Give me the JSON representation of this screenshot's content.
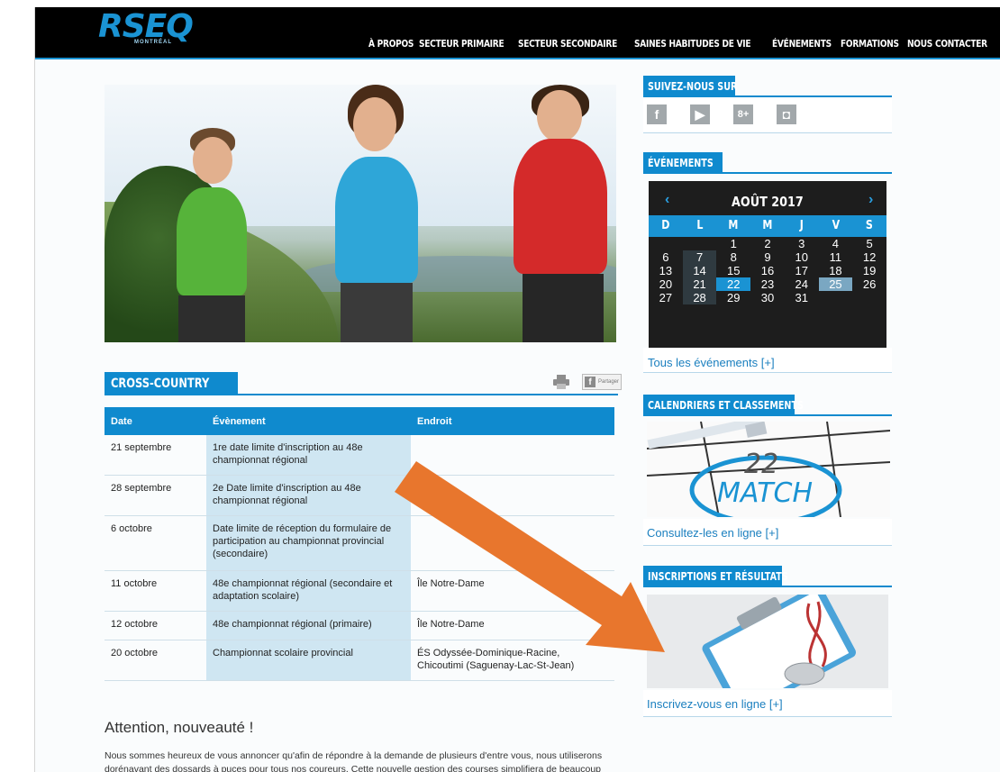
{
  "header": {
    "logo_text": "RSEQ",
    "logo_subtext": "MONTRÉAL",
    "nav": [
      "À PROPOS",
      "SECTEUR PRIMAIRE",
      "SECTEUR SECONDAIRE",
      "SAINES HABITUDES DE VIE",
      "ÉVÉNEMENTS",
      "FORMATIONS",
      "NOUS CONTACTER"
    ]
  },
  "colors": {
    "brand_blue": "#0f8ace",
    "arrow_orange": "#e8762d",
    "calendar_bg": "#1d1d1d"
  },
  "main": {
    "section_title": "CROSS-COUNTRY",
    "share_label": "Partager",
    "table": {
      "headers": [
        "Date",
        "Évènement",
        "Endroit"
      ],
      "rows": [
        {
          "date": "21 septembre",
          "event": "1re date limite d'inscription au 48e championnat régional",
          "place": ""
        },
        {
          "date": "28 septembre",
          "event": "2e Date limite d'inscription au 48e championnat régional",
          "place": ""
        },
        {
          "date": "6 octobre",
          "event": "Date limite de réception du formulaire de participation au championnat provincial (secondaire)",
          "place": ""
        },
        {
          "date": "11 octobre",
          "event": "48e championnat régional (secondaire et adaptation scolaire)",
          "place": "Île Notre-Dame"
        },
        {
          "date": "12 octobre",
          "event": "48e championnat régional (primaire)",
          "place": "Île Notre-Dame"
        },
        {
          "date": "20 octobre",
          "event": "Championnat scolaire provincial",
          "place": "ÉS Odyssée-Dominique-Racine, Chicoutimi (Saguenay-Lac-St-Jean)"
        }
      ]
    },
    "attention_title": "Attention, nouveauté !",
    "body_text": "Nous sommes heureux de vous annoncer qu'afin de répondre à la demande de plusieurs d'entre vous, nous utiliserons dorénavant des dossards à puces pour tous nos coureurs. Cette nouvelle gestion des courses simplifiera de beaucoup"
  },
  "sidebar": {
    "social_title": "SUIVEZ-NOUS SUR",
    "social_icons": [
      "facebook-icon",
      "youtube-icon",
      "google-plus-icon",
      "instagram-icon"
    ],
    "events_title": "ÉVÉNEMENTS",
    "calendar": {
      "month": "AOÛT 2017",
      "prev": "‹",
      "next": "›",
      "weekdays": [
        "D",
        "L",
        "M",
        "M",
        "J",
        "V",
        "S"
      ],
      "leading_blanks": 2,
      "days": 31,
      "highlight_today": 22,
      "highlight_selected": 25
    },
    "events_link": "Tous les événements [+]",
    "calendars_title": "CALENDRIERS ET CLASSEMENTS",
    "match_text": "MATCH",
    "match_number": "22",
    "calendars_link": "Consultez-les en ligne [+]",
    "inscriptions_title": "INSCRIPTIONS ET RÉSULTATS",
    "inscriptions_link": "Inscrivez-vous en ligne [+]"
  }
}
